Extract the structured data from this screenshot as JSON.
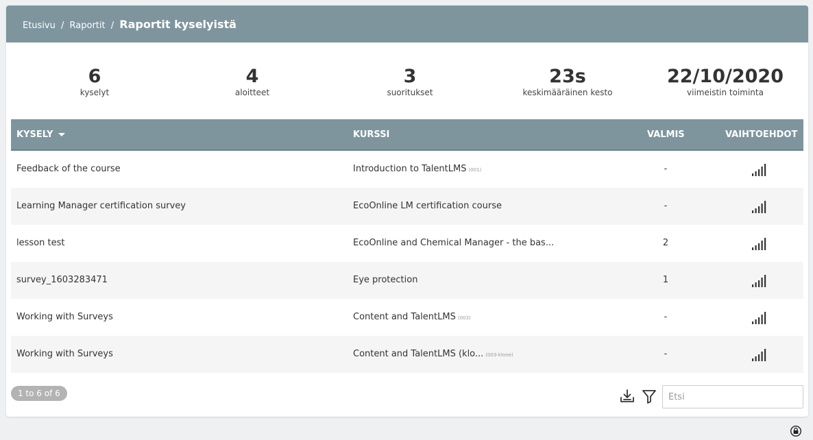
{
  "breadcrumb": {
    "home": "Etusivu",
    "reports": "Raportit",
    "current": "Raportit kyselyistä",
    "separator": "/"
  },
  "stats": [
    {
      "value": "6",
      "label": "kyselyt"
    },
    {
      "value": "4",
      "label": "aloitteet"
    },
    {
      "value": "3",
      "label": "suoritukset"
    },
    {
      "value": "23s",
      "label": "keskimääräinen kesto"
    },
    {
      "value": "22/10/2020",
      "label": "viimeistin toiminta"
    }
  ],
  "table": {
    "headers": {
      "survey": "KYSELY",
      "course": "KURSSI",
      "done": "VALMIS",
      "options": "VAIHTOEHDOT"
    },
    "rows": [
      {
        "survey": "Feedback of the course",
        "course": "Introduction to TalentLMS",
        "code": "(001)",
        "done": "-"
      },
      {
        "survey": "Learning Manager certification survey",
        "course": "EcoOnline LM certification course",
        "code": "",
        "done": "-"
      },
      {
        "survey": "lesson test",
        "course": "EcoOnline and Chemical Manager - the bas...",
        "code": "",
        "done": "2"
      },
      {
        "survey": "survey_1603283471",
        "course": "Eye protection",
        "code": "",
        "done": "1"
      },
      {
        "survey": "Working with Surveys",
        "course": "Content and TalentLMS",
        "code": "(003)",
        "done": "-"
      },
      {
        "survey": "Working with Surveys",
        "course": "Content and TalentLMS (klo...",
        "code": "(003-klone)",
        "done": "-"
      }
    ]
  },
  "footer": {
    "pager": "1 to 6 of 6",
    "search_placeholder": "Etsi"
  },
  "icons": {
    "options": "signal-bars-icon",
    "download": "download-icon",
    "filter": "filter-icon",
    "lock": "lock-icon"
  },
  "colors": {
    "header_bg": "#7e959e",
    "row_alt": "#f5f5f5",
    "pager_bg": "#b3b3b3"
  }
}
